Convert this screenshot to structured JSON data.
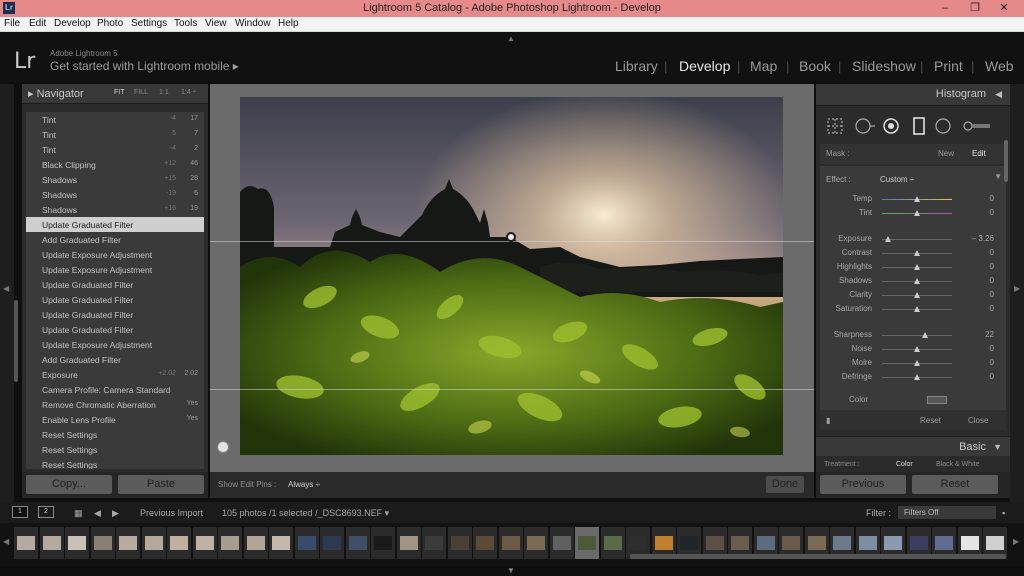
{
  "window": {
    "title": "Lightroom 5 Catalog - Adobe Photoshop Lightroom - Develop",
    "app_icon": "Lr",
    "minimize": "–",
    "maximize": "❐",
    "close": "✕"
  },
  "menu": [
    "File",
    "Edit",
    "Develop",
    "Photo",
    "Settings",
    "Tools",
    "View",
    "Window",
    "Help"
  ],
  "identity": {
    "logo": "Lr",
    "brand": "Adobe Lightroom 5",
    "mobile": "Get started with Lightroom mobile ▸"
  },
  "modules": [
    "Library",
    "Develop",
    "Map",
    "Book",
    "Slideshow",
    "Print",
    "Web"
  ],
  "active_module": "Develop",
  "navigator": {
    "title": "Navigator",
    "zoom": [
      "FIT",
      "FILL",
      "1:1",
      "1:4 ÷"
    ],
    "active_zoom": "FIT"
  },
  "history": [
    {
      "label": "Tint",
      "v1": "-4",
      "v2": "17"
    },
    {
      "label": "Tint",
      "v1": "5",
      "v2": "7"
    },
    {
      "label": "Tint",
      "v1": "-4",
      "v2": "2"
    },
    {
      "label": "Black Clipping",
      "v1": "+12",
      "v2": "46"
    },
    {
      "label": "Shadows",
      "v1": "+15",
      "v2": "28"
    },
    {
      "label": "Shadows",
      "v1": "-19",
      "v2": "6"
    },
    {
      "label": "Shadows",
      "v1": "+16",
      "v2": "19"
    },
    {
      "label": "Update Graduated Filter",
      "v1": "",
      "v2": ""
    },
    {
      "label": "Add Graduated Filter",
      "v1": "",
      "v2": ""
    },
    {
      "label": "Update Exposure Adjustment",
      "v1": "",
      "v2": ""
    },
    {
      "label": "Update Exposure Adjustment",
      "v1": "",
      "v2": ""
    },
    {
      "label": "Update Graduated Filter",
      "v1": "",
      "v2": ""
    },
    {
      "label": "Update Graduated Filter",
      "v1": "",
      "v2": ""
    },
    {
      "label": "Update Graduated Filter",
      "v1": "",
      "v2": ""
    },
    {
      "label": "Update Graduated Filter",
      "v1": "",
      "v2": ""
    },
    {
      "label": "Update Exposure Adjustment",
      "v1": "",
      "v2": ""
    },
    {
      "label": "Add Graduated Filter",
      "v1": "",
      "v2": ""
    },
    {
      "label": "Exposure",
      "v1": "+2.02",
      "v2": "2.02"
    },
    {
      "label": "Camera Profile: Camera Standard",
      "v1": "",
      "v2": ""
    },
    {
      "label": "Remove Chromatic Aberration",
      "v1": "",
      "v2": "Yes"
    },
    {
      "label": "Enable Lens Profile",
      "v1": "",
      "v2": "Yes"
    },
    {
      "label": "Reset Settings",
      "v1": "",
      "v2": ""
    },
    {
      "label": "Reset Settings",
      "v1": "",
      "v2": ""
    },
    {
      "label": "Reset Settings",
      "v1": "",
      "v2": ""
    }
  ],
  "selected_history_index": 7,
  "left_buttons": {
    "copy": "Copy...",
    "paste": "Paste"
  },
  "toolbar": {
    "label": "Show Edit Pins :",
    "value": "Always ÷",
    "done": "Done"
  },
  "right_panel": {
    "histogram_title": "Histogram",
    "mask_label": "Mask :",
    "mask_new": "New",
    "mask_edit": "Edit",
    "effect_label": "Effect :",
    "effect_value": "Custom ÷",
    "sliders": [
      {
        "label": "Temp",
        "value": "0",
        "pos": 0.5,
        "track": "temp"
      },
      {
        "label": "Tint",
        "value": "0",
        "pos": 0.5,
        "track": "tint"
      },
      {
        "label": "Exposure",
        "value": "– 3.26",
        "pos": 0.09,
        "track": "plain"
      },
      {
        "label": "Contrast",
        "value": "0",
        "pos": 0.5,
        "track": "plain"
      },
      {
        "label": "Highlights",
        "value": "0",
        "pos": 0.5,
        "track": "plain"
      },
      {
        "label": "Shadows",
        "value": "0",
        "pos": 0.5,
        "track": "plain"
      },
      {
        "label": "Clarity",
        "value": "0",
        "pos": 0.5,
        "track": "plain"
      },
      {
        "label": "Saturation",
        "value": "0",
        "pos": 0.5,
        "track": "plain"
      },
      {
        "label": "Sharpness",
        "value": "22",
        "pos": 0.61,
        "track": "plain"
      },
      {
        "label": "Noise",
        "value": "0",
        "pos": 0.5,
        "track": "plain"
      },
      {
        "label": "Moire",
        "value": "0",
        "pos": 0.5,
        "track": "plain"
      },
      {
        "label": "Defringe",
        "value": "0",
        "pos": 0.5,
        "track": "plain"
      }
    ],
    "color_label": "Color",
    "reset": "Reset",
    "close": "Close",
    "basic_title": "Basic",
    "treatment_label": "Treatment :",
    "treatment_color": "Color",
    "treatment_bw": "Black & White",
    "previous": "Previous",
    "reset_button": "Reset"
  },
  "filmstrip": {
    "view1": "1",
    "view2": "2",
    "source": "Previous Import",
    "count": "105 photos /1 selected /_DSC8693.NEF ▾",
    "filter_label": "Filter :",
    "filter_value": "Filters Off"
  },
  "colors": {
    "titlebar": "#e6898a",
    "panel": "#2b2b2b",
    "accent_text": "#e8e8e8"
  }
}
